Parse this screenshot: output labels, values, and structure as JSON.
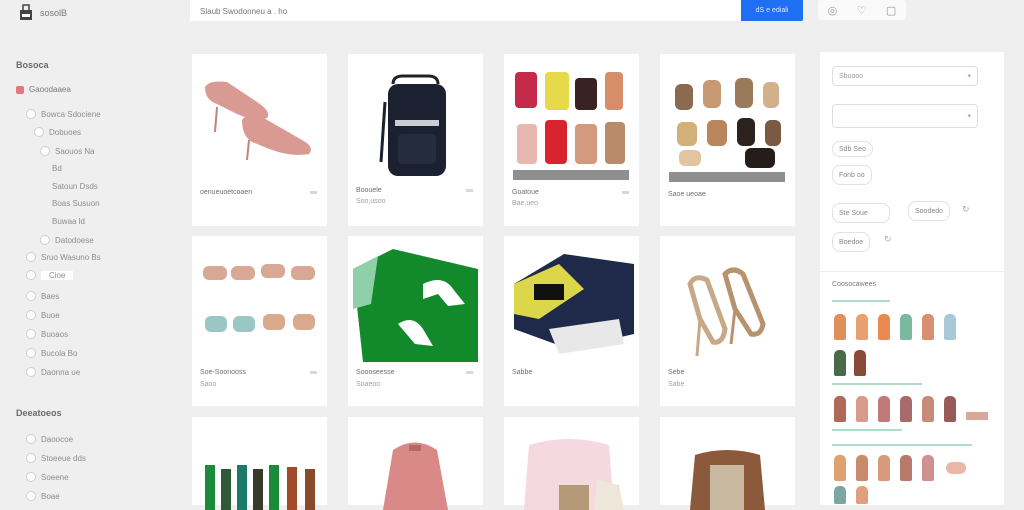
{
  "header": {
    "logo_text": "sosolB",
    "search_placeholder": "Slaub Swodonneu a . ho",
    "search_button": "dS  e  ediali",
    "top_icons": [
      "camera-icon",
      "heart-icon",
      "bag-icon"
    ]
  },
  "sidebar": {
    "section1_title": "Bosoca",
    "main_item": "Gaoodaaea",
    "items": [
      "Bowca Sdociene",
      "Dobuoes",
      "Saouos Na",
      "Bd",
      "Satoun Dsds",
      "Boas Susuon",
      "Buwaa ld",
      "Datodoese",
      "Sruo Wasuno Bs",
      "Cioe",
      "Baes",
      "Buoe",
      "Buoaos",
      "Bucola Bo",
      "Daonna ue"
    ],
    "section2_title": "Deeatoeos",
    "items2": [
      "Daoocoe",
      "Stoeeue dds",
      "Soeene",
      "Boae"
    ]
  },
  "products": [
    {
      "title": "oenueuoetcoaen",
      "sub": ""
    },
    {
      "title": "Boouele",
      "sub": "Soo,usoo"
    },
    {
      "title": "Goatoue",
      "sub": "Bae,ueo"
    },
    {
      "title": "Saoe ueoae",
      "sub": ""
    },
    {
      "title": "Soe-Soonooss",
      "sub": "Saoo"
    },
    {
      "title": "Soooseesse",
      "sub": "Soaeoo"
    },
    {
      "title": "Sabbe",
      "sub": ""
    },
    {
      "title": "Sebe",
      "sub": "Sabe"
    },
    {
      "title": "",
      "sub": ""
    },
    {
      "title": "",
      "sub": ""
    },
    {
      "title": "",
      "sub": ""
    },
    {
      "title": "",
      "sub": ""
    }
  ],
  "filters": {
    "select1": "Sbuooo",
    "select2": "",
    "chip1": "Sdb Seo",
    "chip2": "Fonb oo",
    "chip3": "Ste Soue",
    "chip4": "Soodedo",
    "chip5": "Boedoe"
  },
  "recommend_title": "Coosocawees",
  "colors": {
    "accent": "#1e6ff2",
    "background": "#efefef",
    "card": "#ffffff"
  }
}
